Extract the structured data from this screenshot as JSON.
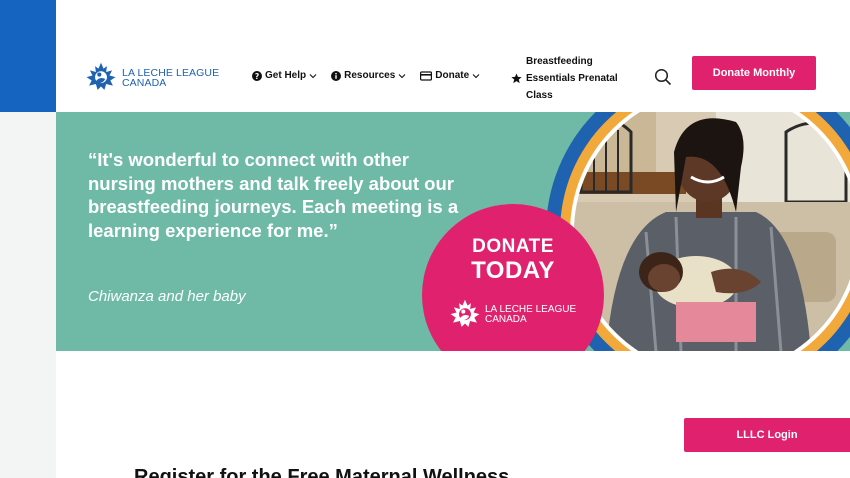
{
  "brand": {
    "logo_line1": "LA LECHE LEAGUE",
    "logo_line2": "CANADA",
    "primary_blue": "#1f62b0",
    "accent_pink": "#e0226e",
    "hero_teal": "#6ebaa6"
  },
  "nav": {
    "items": [
      {
        "label": "Get Help",
        "icon": "question-circle-icon"
      },
      {
        "label": "Resources",
        "icon": "info-circle-icon"
      },
      {
        "label": "Donate",
        "icon": "credit-card-icon"
      }
    ],
    "essentials_line1": "Breastfeeding",
    "essentials_line2": "Essentials Prenatal",
    "essentials_line3": "Class",
    "essentials_icon": "star-icon",
    "search_icon": "search-icon",
    "donate_monthly": "Donate Monthly"
  },
  "hero": {
    "quote": "“It's wonderful to connect with other nursing mothers and talk freely about our breastfeeding journeys. Each meeting is a learning experience for me.”",
    "caption": "Chiwanza and her baby",
    "donate_line1": "DONATE",
    "donate_line2": "TODAY",
    "donate_logo_line1": "LA LECHE LEAGUE",
    "donate_logo_line2": "CANADA"
  },
  "login": {
    "label": "LLLC Login"
  },
  "main": {
    "heading": "Register for the Free Maternal Wellness"
  }
}
